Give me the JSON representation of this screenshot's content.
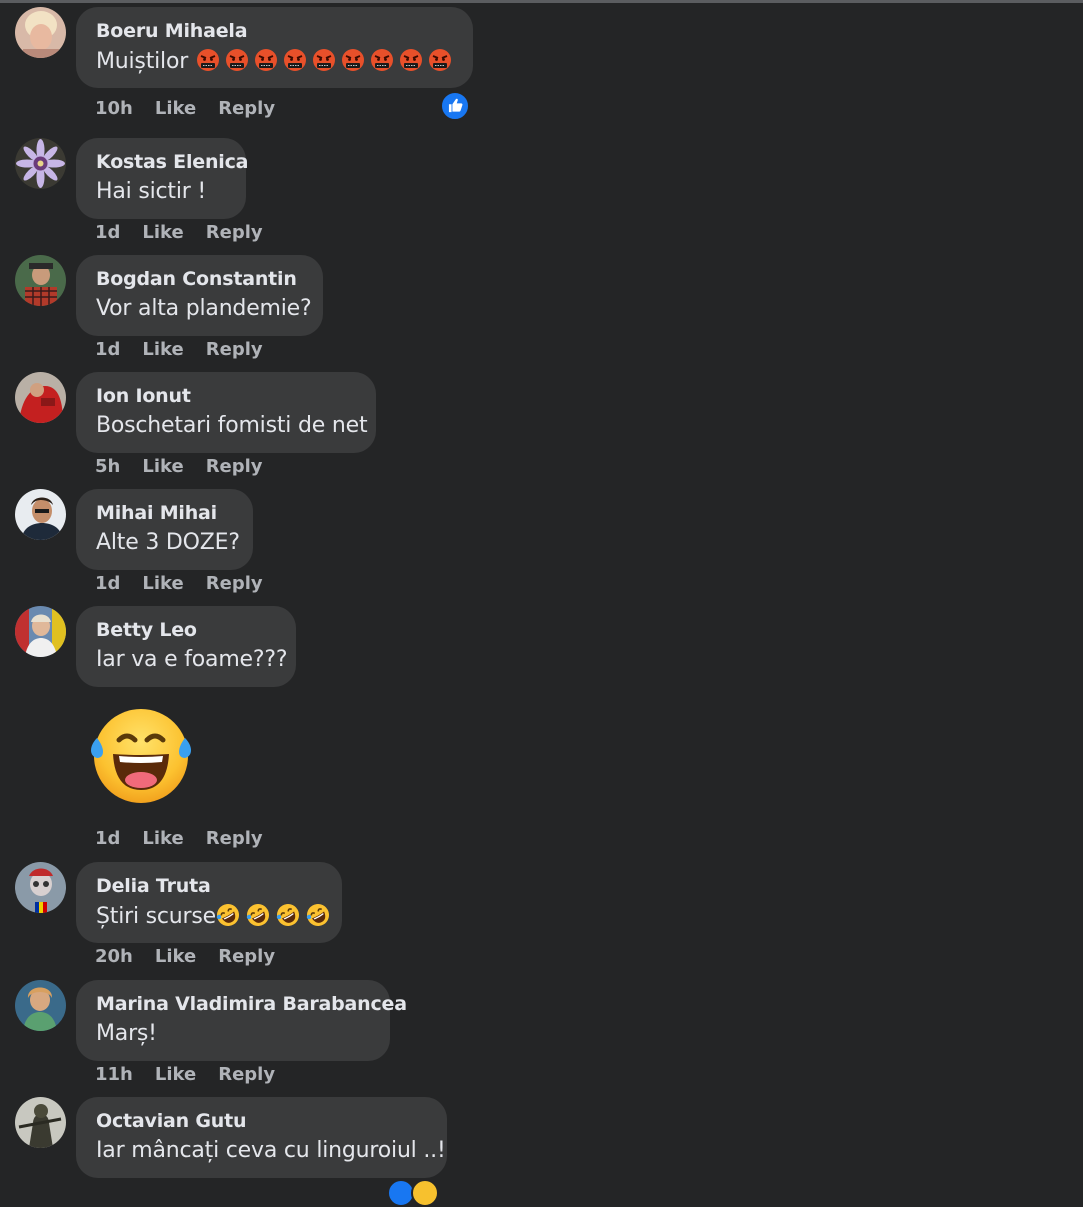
{
  "comments": [
    {
      "author": "Boeru Mihaela",
      "text": "Muiștilor",
      "time": "10h",
      "like": "Like",
      "reply": "Reply",
      "emoji": "angry-cursing-face",
      "emoji_count": 9
    },
    {
      "author": "Kostas Elenica",
      "text": "Hai sictir !",
      "time": "1d",
      "like": "Like",
      "reply": "Reply"
    },
    {
      "author": "Bogdan Constantin",
      "text": "Vor alta plandemie?",
      "time": "1d",
      "like": "Like",
      "reply": "Reply"
    },
    {
      "author": "Ion Ionut",
      "text": "Boschetari fomisti de net",
      "time": "5h",
      "like": "Like",
      "reply": "Reply"
    },
    {
      "author": "Mihai Mihai",
      "text": "Alte 3 DOZE?",
      "time": "1d",
      "like": "Like",
      "reply": "Reply"
    },
    {
      "author": "Betty Leo",
      "text": "Iar va e foame???",
      "time": "1d",
      "like": "Like",
      "reply": "Reply",
      "sticker": "laughing-tears-emoji"
    },
    {
      "author": "Delia Truta",
      "text": "Știri scurse",
      "time": "20h",
      "like": "Like",
      "reply": "Reply",
      "emoji": "rolling-laughing-face",
      "emoji_count": 4
    },
    {
      "author": "Marina Vladimira Barabancea",
      "text": "Marș!",
      "time": "11h",
      "like": "Like",
      "reply": "Reply"
    },
    {
      "author": "Octavian Gutu",
      "text": "Iar mâncați ceva cu linguroiul ..!",
      "time": "",
      "like": "",
      "reply": ""
    }
  ],
  "colors": {
    "background": "#242526",
    "bubble": "#3a3b3c",
    "text": "#e4e6eb",
    "secondary": "#b0b3b8",
    "like_blue": "#1877f2"
  }
}
